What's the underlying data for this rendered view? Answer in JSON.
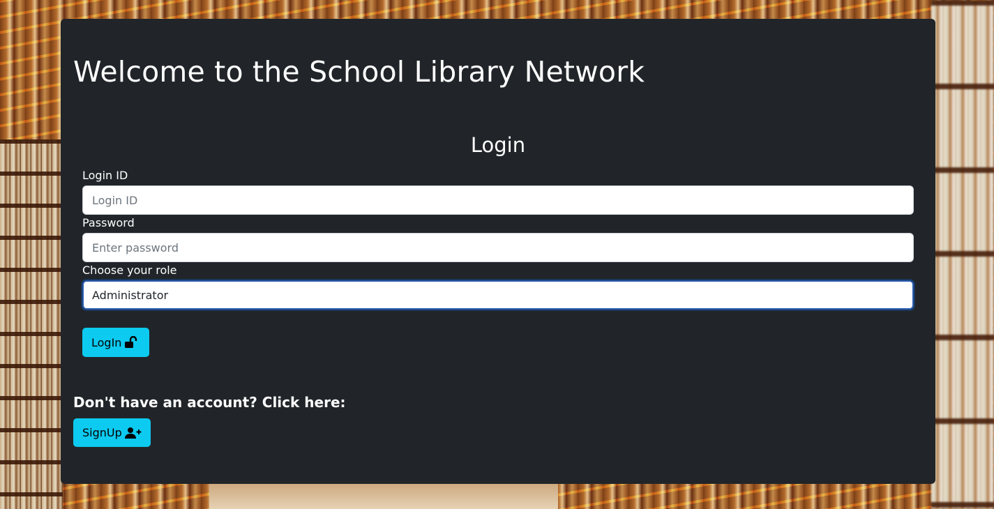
{
  "page": {
    "title": "Welcome to the School Library Network"
  },
  "login": {
    "heading": "Login",
    "login_id_label": "Login ID",
    "login_id_placeholder": "Login ID",
    "login_id_value": "",
    "password_label": "Password",
    "password_placeholder": "Enter password",
    "password_value": "",
    "role_label": "Choose your role",
    "role_selected": "Administrator",
    "button_label": "LogIn",
    "button_icon": "unlock-icon"
  },
  "signup": {
    "prompt": "Don't have an account? Click here:",
    "button_label": "SignUp",
    "button_icon": "user-plus-icon"
  },
  "colors": {
    "card_background": "#212529",
    "button_accent": "#0dcaf0",
    "focus_border": "#2a5db0"
  }
}
